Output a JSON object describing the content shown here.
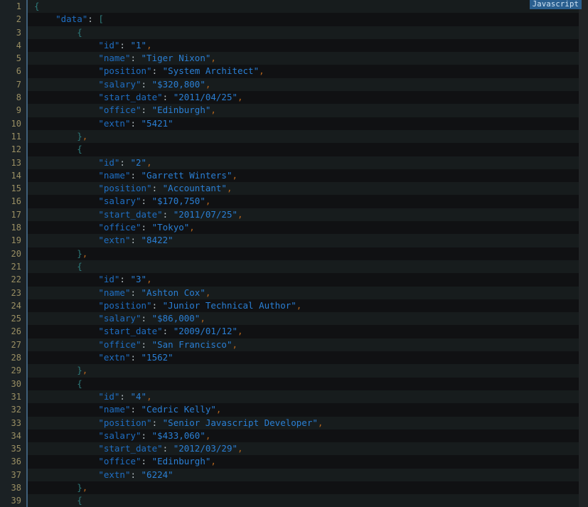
{
  "badge": {
    "label": "Javascript",
    "bg_color": "#2a5f8f",
    "text_color": "#cfe4f5"
  },
  "editor": {
    "background": "#121214",
    "gutter_background": "#1b2124",
    "gutter_divider_color": "#3f5f7a",
    "stripe_odd": "#171c1d",
    "stripe_even": "#101113",
    "line_number_color": "#9a8f63",
    "first_line": 1,
    "last_line": 39,
    "total_visible_lines": 39,
    "indent_unit": "    "
  },
  "syntax_colors": {
    "key": "#1f6fc4",
    "string": "#2a7fd4",
    "brace": "#2e7d7d",
    "punctuation": "#b4bec2",
    "comma": "#b5651d"
  },
  "document": {
    "language": "Javascript",
    "root_key": "data",
    "records": [
      {
        "id": "1",
        "name": "Tiger Nixon",
        "position": "System Architect",
        "salary": "$320,800",
        "start_date": "2011/04/25",
        "office": "Edinburgh",
        "extn": "5421"
      },
      {
        "id": "2",
        "name": "Garrett Winters",
        "position": "Accountant",
        "salary": "$170,750",
        "start_date": "2011/07/25",
        "office": "Tokyo",
        "extn": "8422"
      },
      {
        "id": "3",
        "name": "Ashton Cox",
        "position": "Junior Technical Author",
        "salary": "$86,000",
        "start_date": "2009/01/12",
        "office": "San Francisco",
        "extn": "1562"
      },
      {
        "id": "4",
        "name": "Cedric Kelly",
        "position": "Senior Javascript Developer",
        "salary": "$433,060",
        "start_date": "2012/03/29",
        "office": "Edinburgh",
        "extn": "6224"
      }
    ]
  },
  "lines": [
    {
      "n": 1,
      "indent": 0,
      "type": "open_brace",
      "text": "{"
    },
    {
      "n": 2,
      "indent": 1,
      "type": "key_array",
      "key": "data",
      "text": "\"data\": ["
    },
    {
      "n": 3,
      "indent": 2,
      "type": "open_brace",
      "text": "{"
    },
    {
      "n": 4,
      "indent": 3,
      "type": "pair",
      "key": "id",
      "value": "1",
      "trailing_comma": true
    },
    {
      "n": 5,
      "indent": 3,
      "type": "pair",
      "key": "name",
      "value": "Tiger Nixon",
      "trailing_comma": true
    },
    {
      "n": 6,
      "indent": 3,
      "type": "pair",
      "key": "position",
      "value": "System Architect",
      "trailing_comma": true
    },
    {
      "n": 7,
      "indent": 3,
      "type": "pair",
      "key": "salary",
      "value": "$320,800",
      "trailing_comma": true
    },
    {
      "n": 8,
      "indent": 3,
      "type": "pair",
      "key": "start_date",
      "value": "2011/04/25",
      "trailing_comma": true
    },
    {
      "n": 9,
      "indent": 3,
      "type": "pair",
      "key": "office",
      "value": "Edinburgh",
      "trailing_comma": true
    },
    {
      "n": 10,
      "indent": 3,
      "type": "pair",
      "key": "extn",
      "value": "5421",
      "trailing_comma": false
    },
    {
      "n": 11,
      "indent": 2,
      "type": "close_brace",
      "text": "},",
      "trailing_comma": true
    },
    {
      "n": 12,
      "indent": 2,
      "type": "open_brace",
      "text": "{"
    },
    {
      "n": 13,
      "indent": 3,
      "type": "pair",
      "key": "id",
      "value": "2",
      "trailing_comma": true
    },
    {
      "n": 14,
      "indent": 3,
      "type": "pair",
      "key": "name",
      "value": "Garrett Winters",
      "trailing_comma": true
    },
    {
      "n": 15,
      "indent": 3,
      "type": "pair",
      "key": "position",
      "value": "Accountant",
      "trailing_comma": true
    },
    {
      "n": 16,
      "indent": 3,
      "type": "pair",
      "key": "salary",
      "value": "$170,750",
      "trailing_comma": true
    },
    {
      "n": 17,
      "indent": 3,
      "type": "pair",
      "key": "start_date",
      "value": "2011/07/25",
      "trailing_comma": true
    },
    {
      "n": 18,
      "indent": 3,
      "type": "pair",
      "key": "office",
      "value": "Tokyo",
      "trailing_comma": true
    },
    {
      "n": 19,
      "indent": 3,
      "type": "pair",
      "key": "extn",
      "value": "8422",
      "trailing_comma": false
    },
    {
      "n": 20,
      "indent": 2,
      "type": "close_brace",
      "text": "},",
      "trailing_comma": true
    },
    {
      "n": 21,
      "indent": 2,
      "type": "open_brace",
      "text": "{"
    },
    {
      "n": 22,
      "indent": 3,
      "type": "pair",
      "key": "id",
      "value": "3",
      "trailing_comma": true
    },
    {
      "n": 23,
      "indent": 3,
      "type": "pair",
      "key": "name",
      "value": "Ashton Cox",
      "trailing_comma": true
    },
    {
      "n": 24,
      "indent": 3,
      "type": "pair",
      "key": "position",
      "value": "Junior Technical Author",
      "trailing_comma": true
    },
    {
      "n": 25,
      "indent": 3,
      "type": "pair",
      "key": "salary",
      "value": "$86,000",
      "trailing_comma": true
    },
    {
      "n": 26,
      "indent": 3,
      "type": "pair",
      "key": "start_date",
      "value": "2009/01/12",
      "trailing_comma": true
    },
    {
      "n": 27,
      "indent": 3,
      "type": "pair",
      "key": "office",
      "value": "San Francisco",
      "trailing_comma": true
    },
    {
      "n": 28,
      "indent": 3,
      "type": "pair",
      "key": "extn",
      "value": "1562",
      "trailing_comma": false
    },
    {
      "n": 29,
      "indent": 2,
      "type": "close_brace",
      "text": "},",
      "trailing_comma": true
    },
    {
      "n": 30,
      "indent": 2,
      "type": "open_brace",
      "text": "{"
    },
    {
      "n": 31,
      "indent": 3,
      "type": "pair",
      "key": "id",
      "value": "4",
      "trailing_comma": true
    },
    {
      "n": 32,
      "indent": 3,
      "type": "pair",
      "key": "name",
      "value": "Cedric Kelly",
      "trailing_comma": true
    },
    {
      "n": 33,
      "indent": 3,
      "type": "pair",
      "key": "position",
      "value": "Senior Javascript Developer",
      "trailing_comma": true
    },
    {
      "n": 34,
      "indent": 3,
      "type": "pair",
      "key": "salary",
      "value": "$433,060",
      "trailing_comma": true
    },
    {
      "n": 35,
      "indent": 3,
      "type": "pair",
      "key": "start_date",
      "value": "2012/03/29",
      "trailing_comma": true
    },
    {
      "n": 36,
      "indent": 3,
      "type": "pair",
      "key": "office",
      "value": "Edinburgh",
      "trailing_comma": true
    },
    {
      "n": 37,
      "indent": 3,
      "type": "pair",
      "key": "extn",
      "value": "6224",
      "trailing_comma": false
    },
    {
      "n": 38,
      "indent": 2,
      "type": "close_brace",
      "text": "},",
      "trailing_comma": true
    },
    {
      "n": 39,
      "indent": 2,
      "type": "open_brace",
      "text": "{"
    }
  ]
}
